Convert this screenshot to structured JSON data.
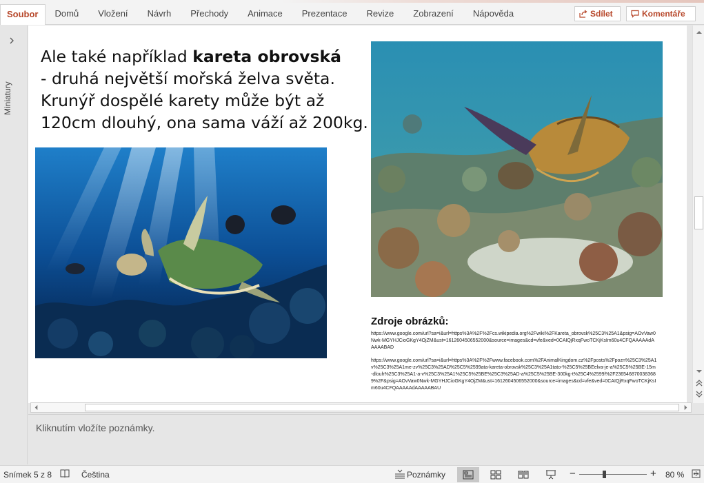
{
  "ribbon": {
    "tabs": [
      "Soubor",
      "Domů",
      "Vložení",
      "Návrh",
      "Přechody",
      "Animace",
      "Prezentace",
      "Revize",
      "Zobrazení",
      "Nápověda"
    ],
    "share_label": "Sdílet",
    "comments_label": "Komentáře",
    "accent_color": "#b7472a"
  },
  "thumbnails": {
    "label": "Miniatury"
  },
  "slide": {
    "text_before_bold": "Ale také například ",
    "text_bold": "kareta obrovská",
    "text_after_bold": "- druhá největší mořská želva světa. Krunýř dospělé karety může být až 120cm dlouhý, ona sama váží až 200kg.",
    "sources_title": "Zdroje obrázků:",
    "source_1": "https://www.google.com/url?sa=i&url=https%3A%2F%2Fcs.wikipedia.org%2Fwiki%2FKareta_obrovsk%25C3%25A1&psig=AOvVaw0Nwk-MGYHJCioGKgY4OjZM&ust=1612604506552000&source=images&cd=vfe&ved=0CAIQjRxqFwoTCKjKsIm60u4CFQAAAAAdAAAAABAD",
    "source_2": "https://www.google.com/url?sa=i&url=https%3A%2F%2Fwww.facebook.com%2FAnimalKingdom.cz%2Fposts%2Fpozn%25C3%25A1v%25C3%25A1me-zv%25C3%25AD%25C5%2599ata-kareta-obrovsk%25C3%25A1tato-%25C5%25BEelva-je-a%25C5%25BE-15m-dlouh%25C3%25A1-a-v%25C3%25A1%25C5%25BE%25C3%25AD-a%25C5%25BE-300kg-t%25C4%2599l%2F2365468700383689%2F&psig=AOvVaw0Nwk-MGYHJCioGKgY4OjZM&ust=1612604506552000&source=images&cd=vfe&ved=0CAIQjRxqFwoTCKjKsIm60u4CFQAAAAAdAAAAABAU"
  },
  "notes": {
    "placeholder": "Kliknutím vložíte poznámky."
  },
  "status": {
    "slide_counter": "Snímek 5 z 8",
    "language": "Čeština",
    "notes_label": "Poznámky",
    "zoom": "80 %"
  }
}
